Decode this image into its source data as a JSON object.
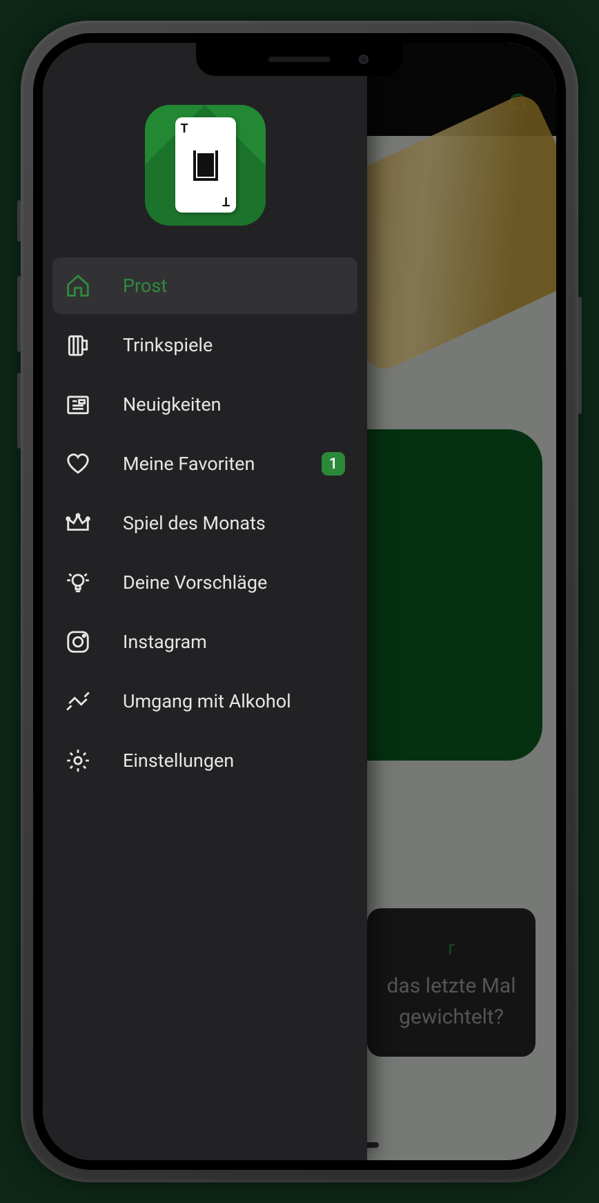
{
  "drawer": {
    "items": [
      {
        "label": "Prost",
        "icon": "home-icon",
        "active": true
      },
      {
        "label": "Trinkspiele",
        "icon": "mug-icon"
      },
      {
        "label": "Neuigkeiten",
        "icon": "news-icon"
      },
      {
        "label": "Meine Favoriten",
        "icon": "heart-icon",
        "badge": "1"
      },
      {
        "label": "Spiel des Monats",
        "icon": "crown-icon"
      },
      {
        "label": "Deine Vorschläge",
        "icon": "lightbulb-icon"
      },
      {
        "label": "Instagram",
        "icon": "instagram-icon"
      },
      {
        "label": "Umgang mit Alkohol",
        "icon": "hands-icon"
      },
      {
        "label": "Einstellungen",
        "icon": "gear-icon"
      }
    ]
  },
  "background": {
    "question_title": "r",
    "question_line1": "das letzte Mal",
    "question_line2": "gewichtelt?"
  }
}
